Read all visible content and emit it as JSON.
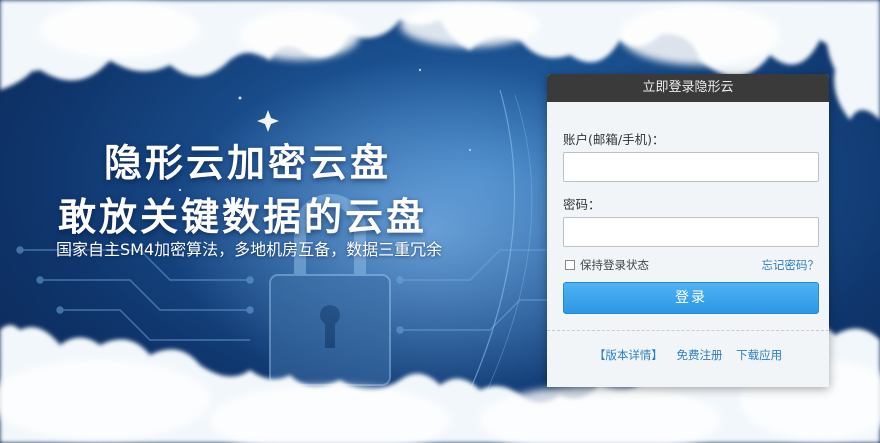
{
  "hero": {
    "title_line1": "隐形云加密云盘",
    "title_line2": "敢放关键数据的云盘",
    "subtitle": "国家自主SM4加密算法，多地机房互备，数据三重冗余"
  },
  "login": {
    "header": "立即登录隐形云",
    "account_label": "账户(邮箱/手机)：",
    "account_value": "",
    "password_label": "密码：",
    "password_value": "",
    "remember_label": "保持登录状态",
    "forgot_label": "忘记密码？",
    "submit_label": "登录",
    "links": {
      "version": "【版本详情】",
      "register": "免费注册",
      "download": "下载应用"
    }
  },
  "colors": {
    "accent": "#2c97e6",
    "link": "#2b7ec0",
    "header_bg": "#3a3a3a",
    "sky": "#1a4f8e"
  },
  "icons": [
    "lock-icon",
    "circuit-decoration",
    "cloud-decoration",
    "star-decoration"
  ]
}
